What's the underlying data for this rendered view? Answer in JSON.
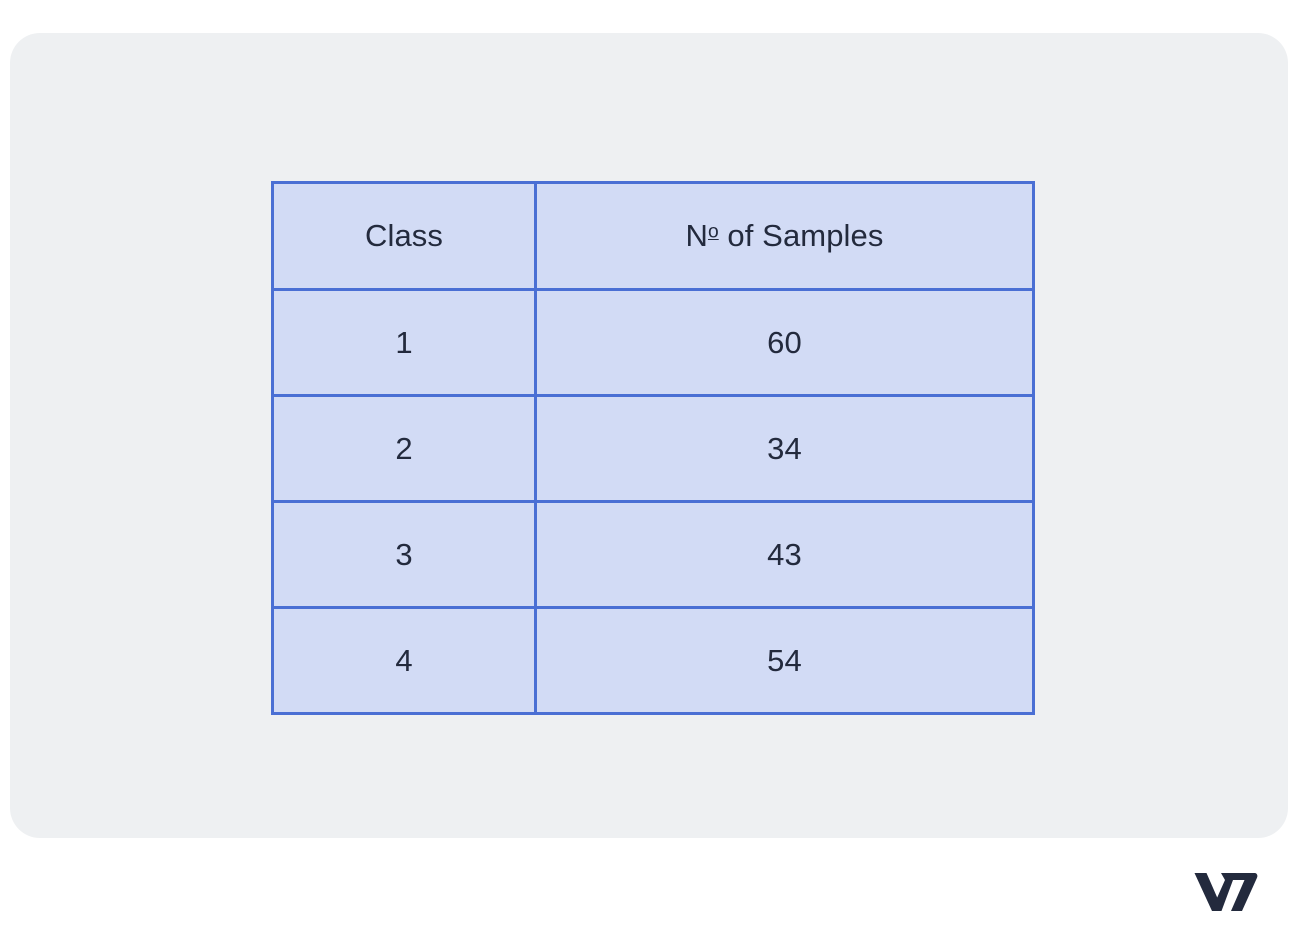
{
  "figure": {
    "card_background": "#eef0f2",
    "page_background": "#ffffff"
  },
  "table": {
    "border_color": "#4a6fd4",
    "cell_background": "#d2dbf5",
    "text_color": "#232a3d",
    "headers": {
      "class": "Class",
      "samples_prefix": "N",
      "samples_ordinal": "o",
      "samples_suffix": " of Samples",
      "samples_full": "Nº of Samples"
    },
    "rows": [
      {
        "class": "1",
        "samples": "60"
      },
      {
        "class": "2",
        "samples": "34"
      },
      {
        "class": "3",
        "samples": "43"
      },
      {
        "class": "4",
        "samples": "54"
      }
    ]
  },
  "chart_data": {
    "type": "table",
    "title": "",
    "columns": [
      "Class",
      "Nº of Samples"
    ],
    "categories": [
      "1",
      "2",
      "3",
      "4"
    ],
    "values": [
      60,
      34,
      43,
      54
    ],
    "series": [
      {
        "name": "Nº of Samples",
        "values": [
          60,
          34,
          43,
          54
        ]
      }
    ],
    "xlabel": "Class",
    "ylabel": "Nº of Samples",
    "grid": true,
    "legend": "none"
  },
  "branding": {
    "logo_name": "V7",
    "logo_color": "#232a3d"
  }
}
